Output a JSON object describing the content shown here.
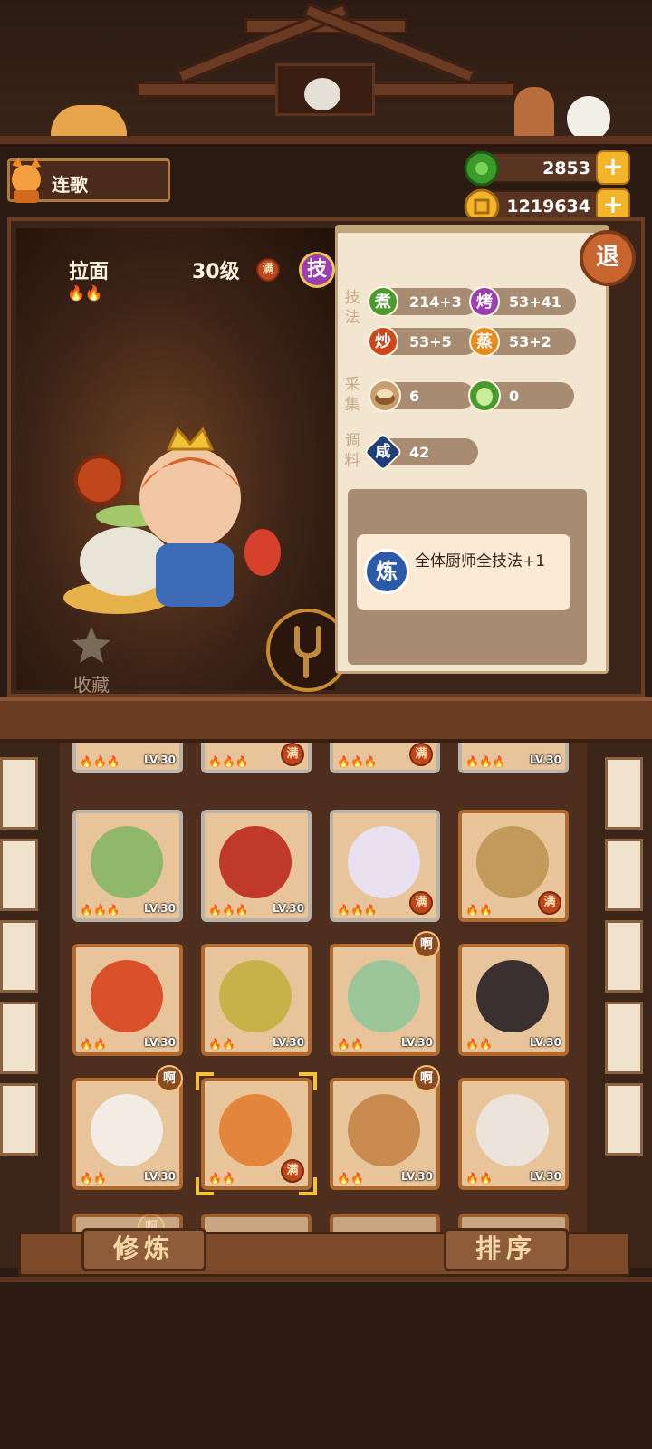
{
  "player": {
    "name": "连歌",
    "avatar_icon": "fox-chef-icon"
  },
  "currencies": [
    {
      "name": "jade",
      "icon": "green-jade-icon",
      "value": "2853",
      "plus": "+"
    },
    {
      "name": "coin",
      "icon": "gold-coin-icon",
      "value": "1219634",
      "plus": "+"
    }
  ],
  "chef": {
    "dish": "拉面",
    "heat": "🔥🔥",
    "level": "30级",
    "full_badge": "满",
    "skill_button": "技",
    "favorite_label": "收藏"
  },
  "exit_button": "退",
  "stats": {
    "technique_label": "技法",
    "cook": {
      "icon": "煮",
      "value": "214+3",
      "color": "#4a9a2e"
    },
    "roast": {
      "icon": "烤",
      "value": "53+41",
      "color": "#9b3fb0"
    },
    "stir": {
      "icon": "炒",
      "value": "53+5",
      "color": "#d0461c"
    },
    "steam": {
      "icon": "蒸",
      "value": "53+2",
      "color": "#e88a1c"
    },
    "gather_label": "采集",
    "grain": {
      "icon": "grain-basket-icon",
      "value": "6"
    },
    "veg": {
      "icon": "cabbage-icon",
      "value": "0"
    },
    "season_label": "调料",
    "salty": {
      "icon": "咸",
      "value": "42",
      "color": "#1f3e7a"
    }
  },
  "ability": {
    "icon": "炼",
    "text": "全体厨师全技法+1"
  },
  "roster": {
    "partial_row": [
      {
        "flames": "🔥🔥🔥",
        "lv": "LV.30"
      },
      {
        "flames": "🔥🔥🔥",
        "full": "满"
      },
      {
        "flames": "🔥🔥🔥",
        "full": "满"
      },
      {
        "flames": "🔥🔥🔥",
        "lv": "LV.30"
      }
    ],
    "cards": [
      {
        "flames": "🔥🔥🔥",
        "lv": "LV.30",
        "color": "#8fb86a",
        "frame": "gray"
      },
      {
        "flames": "🔥🔥🔥",
        "lv": "LV.30",
        "color": "#c0392b",
        "frame": "gray"
      },
      {
        "flames": "🔥🔥🔥",
        "full": "满",
        "color": "#e9e1f0",
        "frame": "gray"
      },
      {
        "flames": "🔥🔥",
        "full": "满",
        "color": "#c49a5a",
        "frame": "gold"
      },
      {
        "flames": "🔥🔥",
        "lv": "LV.30",
        "color": "#d9502a",
        "frame": "gold"
      },
      {
        "flames": "🔥🔥",
        "lv": "LV.30",
        "color": "#c7b24a",
        "frame": "gold"
      },
      {
        "flames": "🔥🔥",
        "lv": "LV.30",
        "color": "#9cc59a",
        "frame": "gold",
        "ah": "啊"
      },
      {
        "flames": "🔥🔥",
        "lv": "LV.30",
        "color": "#3a3030",
        "frame": "gold"
      },
      {
        "flames": "🔥🔥",
        "lv": "LV.30",
        "color": "#f2ece4",
        "frame": "gold",
        "ah": "啊"
      },
      {
        "flames": "🔥🔥",
        "full": "满",
        "color": "#e3853a",
        "frame": "gold",
        "selected": true
      },
      {
        "flames": "🔥🔥",
        "lv": "LV.30",
        "color": "#c98a50",
        "frame": "gold",
        "ah": "啊"
      },
      {
        "flames": "🔥🔥",
        "lv": "LV.30",
        "color": "#ece4da",
        "frame": "gold"
      }
    ],
    "next_row_badge": "啊"
  },
  "buttons": {
    "train": "修炼",
    "sort": "排序"
  }
}
